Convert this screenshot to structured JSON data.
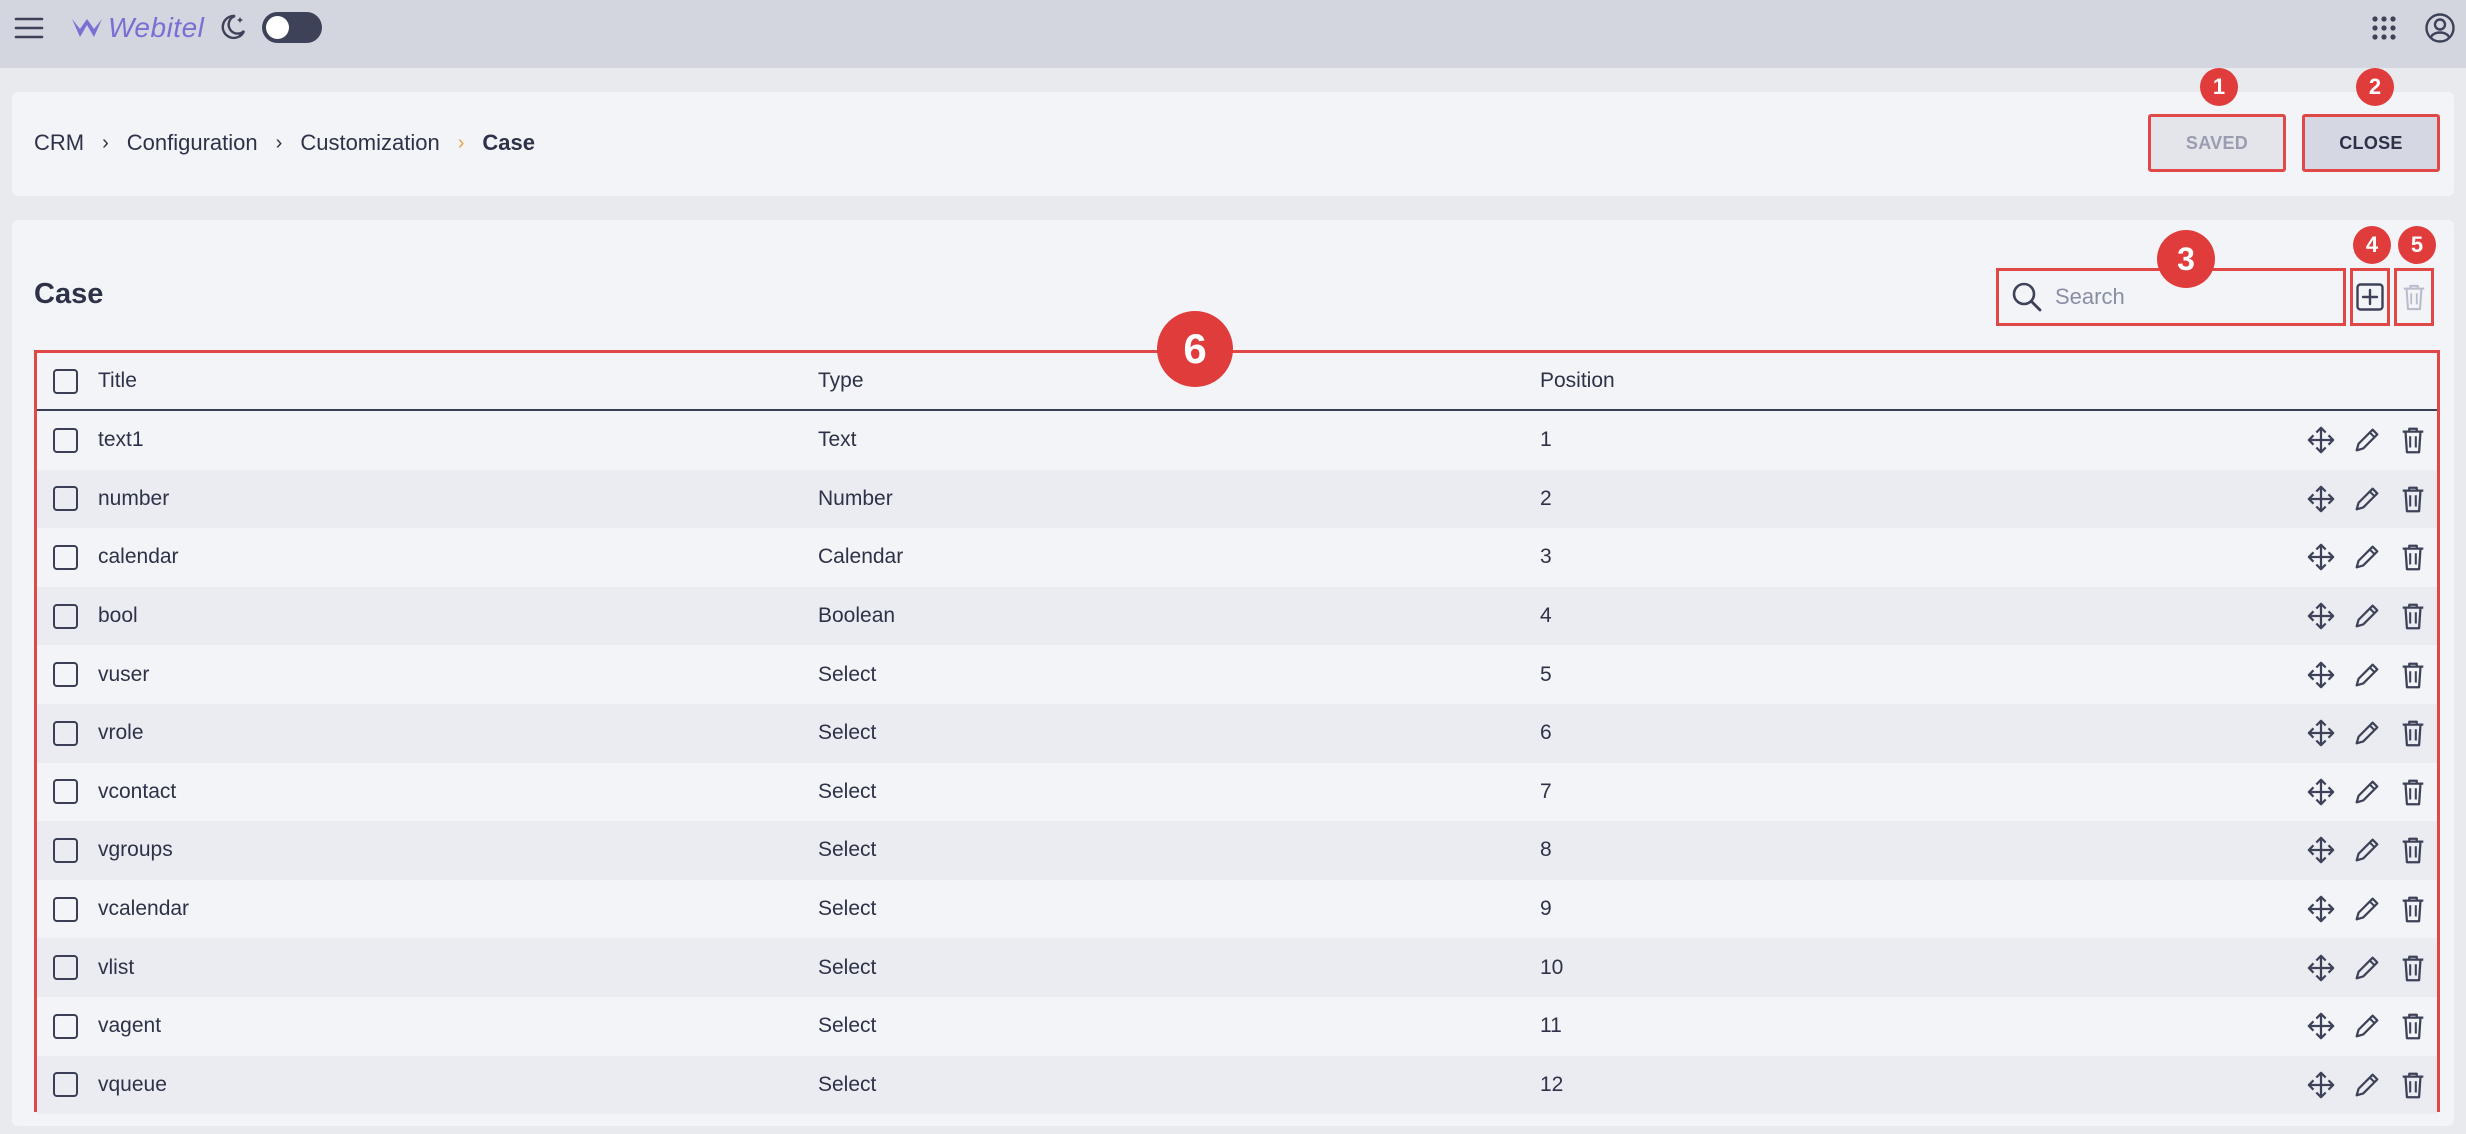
{
  "topbar": {
    "logo_text": "Webitel",
    "icons": [
      "menu-icon",
      "theme-moon-icon",
      "apps-grid-icon",
      "account-icon"
    ]
  },
  "breadcrumb": {
    "items": [
      "CRM",
      "Configuration",
      "Customization"
    ],
    "current": "Case"
  },
  "header_buttons": {
    "saved_label": "SAVED",
    "close_label": "CLOSE"
  },
  "main": {
    "title": "Case",
    "search_placeholder": "Search"
  },
  "table": {
    "columns": [
      "Title",
      "Type",
      "Position"
    ],
    "rows": [
      {
        "title": "text1",
        "type": "Text",
        "position": "1"
      },
      {
        "title": "number",
        "type": "Number",
        "position": "2"
      },
      {
        "title": "calendar",
        "type": "Calendar",
        "position": "3"
      },
      {
        "title": "bool",
        "type": "Boolean",
        "position": "4"
      },
      {
        "title": "vuser",
        "type": "Select",
        "position": "5"
      },
      {
        "title": "vrole",
        "type": "Select",
        "position": "6"
      },
      {
        "title": "vcontact",
        "type": "Select",
        "position": "7"
      },
      {
        "title": "vgroups",
        "type": "Select",
        "position": "8"
      },
      {
        "title": "vcalendar",
        "type": "Select",
        "position": "9"
      },
      {
        "title": "vlist",
        "type": "Select",
        "position": "10"
      },
      {
        "title": "vagent",
        "type": "Select",
        "position": "11"
      },
      {
        "title": "vqueue",
        "type": "Select",
        "position": "12"
      }
    ],
    "row_actions": [
      "move-icon",
      "edit-icon",
      "delete-icon"
    ]
  },
  "annotations": [
    "1",
    "2",
    "3",
    "4",
    "5",
    "6"
  ],
  "colors": {
    "accent_red": "#e04848",
    "badge_red": "#e03c3c",
    "topbar_bg": "#d3d5df",
    "panel_bg": "#f3f4f7",
    "logo_purple": "#7a6fd4",
    "breadcrumb_accent": "#f0a040"
  }
}
